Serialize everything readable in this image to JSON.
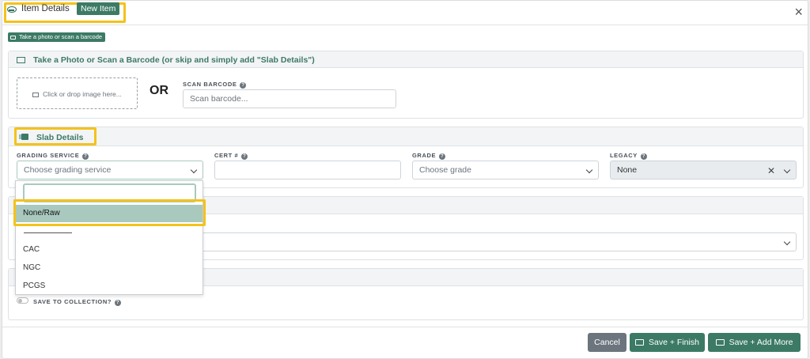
{
  "header": {
    "title": "Item Details",
    "badge": "New Item",
    "close": "×"
  },
  "photo_pill": "Take a photo or scan a barcode",
  "photo_card": {
    "title": "Take a Photo or Scan a Barcode (or skip and simply add \"Slab Details\")",
    "dropzone": "Click or drop image here...",
    "or": "OR",
    "scan_label": "SCAN BARCODE",
    "scan_placeholder": "Scan barcode..."
  },
  "slab": {
    "title": "Slab Details",
    "grading_label": "GRADING SERVICE",
    "grading_placeholder": "Choose grading service",
    "cert_label": "CERT #",
    "grade_label": "GRADE",
    "grade_placeholder": "Choose grade",
    "legacy_label": "LEGACY",
    "legacy_value": "None"
  },
  "dropdown": {
    "options": [
      "None/Raw",
      "CAC",
      "NGC",
      "PCGS"
    ],
    "selected": "None/Raw"
  },
  "collection": {
    "label": "SAVE TO COLLECTION?"
  },
  "footer": {
    "cancel": "Cancel",
    "save_finish": "Save + Finish",
    "save_add": "Save + Add More"
  },
  "help": "?",
  "colors": {
    "accent": "#3c7a66",
    "highlight": "#f4c21a",
    "selected": "#a9c9bf"
  },
  "icons": [
    "coin-icon",
    "camera-icon",
    "image-icon",
    "slab-icon",
    "help-icon",
    "chevron-down-icon",
    "clear-icon",
    "save-icon",
    "close-icon"
  ]
}
